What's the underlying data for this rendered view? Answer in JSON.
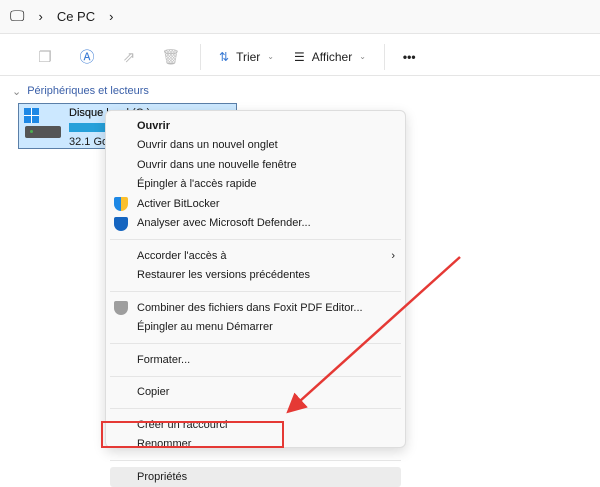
{
  "breadcrumb": {
    "items": [
      "Ce PC"
    ]
  },
  "toolbar": {
    "sort": "Trier",
    "view": "Afficher",
    "more": "•••"
  },
  "section": {
    "title": "Périphériques et lecteurs"
  },
  "drive": {
    "name": "Disque local (C:)",
    "name_visible": "Disque l",
    "size": "32.1 Go",
    "usage_percent": 70,
    "bar_color": "#26a0da"
  },
  "menu": {
    "items": [
      {
        "label": "Ouvrir",
        "bold": true
      },
      {
        "label": "Ouvrir dans un nouvel onglet"
      },
      {
        "label": "Ouvrir dans une nouvelle fenêtre"
      },
      {
        "label": "Épingler à l'accès rapide"
      },
      {
        "label": "Activer BitLocker",
        "icon": "shield-yellow-icon"
      },
      {
        "label": "Analyser avec Microsoft Defender...",
        "icon": "defender-shield-icon"
      },
      {
        "sep": true
      },
      {
        "label": "Accorder l'accès à",
        "submenu": true
      },
      {
        "label": "Restaurer les versions précédentes"
      },
      {
        "sep": true
      },
      {
        "label": "Combiner des fichiers dans Foxit PDF Editor...",
        "icon": "foxit-icon"
      },
      {
        "label": "Épingler au menu Démarrer"
      },
      {
        "sep": true
      },
      {
        "label": "Formater..."
      },
      {
        "sep": true
      },
      {
        "label": "Copier"
      },
      {
        "sep": true
      },
      {
        "label": "Créer un raccourci"
      },
      {
        "label": "Renommer"
      },
      {
        "sep": true
      },
      {
        "label": "Propriétés",
        "highlighted": true
      }
    ]
  },
  "annotation_color": "#e53935"
}
